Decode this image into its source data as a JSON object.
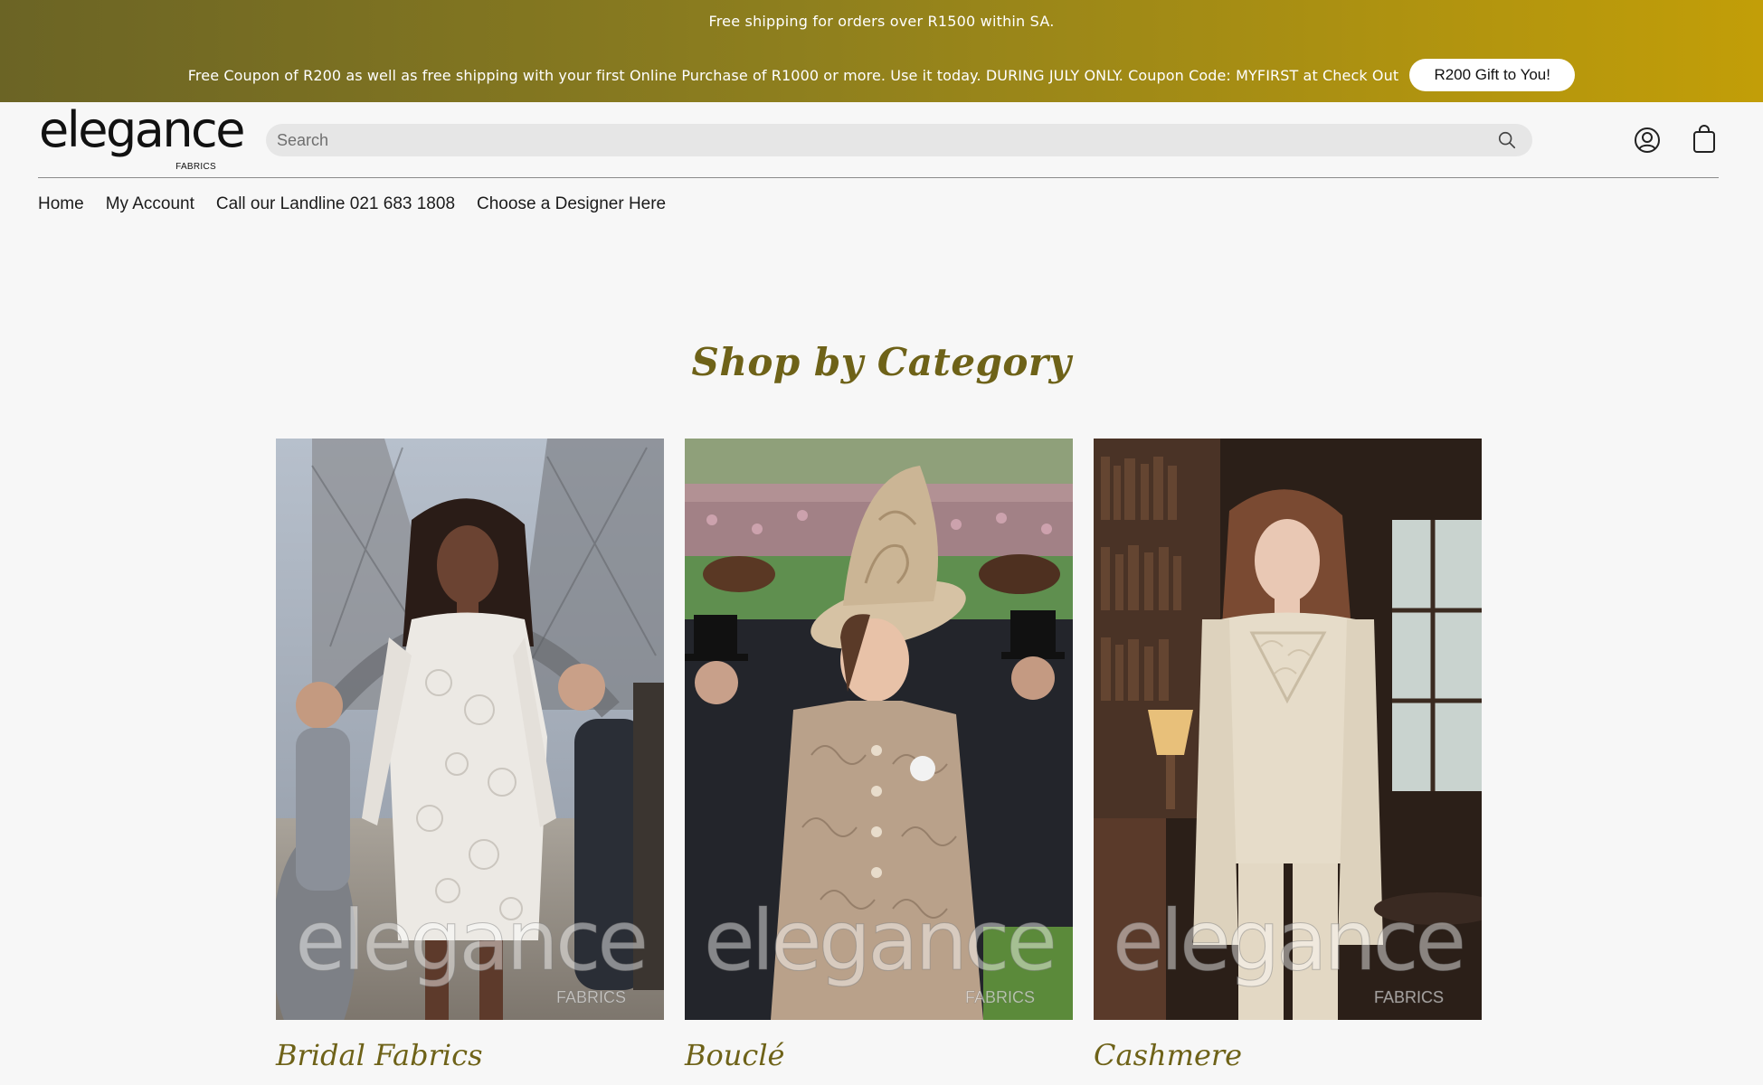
{
  "announcement": {
    "line1": "Free shipping for orders over R1500 within SA.",
    "line2": "Free Coupon of R200 as well as free shipping with your first Online Purchase of R1000 or more. Use it today. DURING JULY ONLY. Coupon Code: MYFIRST at Check Out",
    "gift_button_label": "R200 Gift to You!"
  },
  "header": {
    "logo_text": "elegance",
    "logo_subtext": "FABRICS",
    "search_placeholder": "Search",
    "icons": [
      "search-icon",
      "account-icon",
      "cart-icon"
    ]
  },
  "nav": {
    "items": [
      {
        "label": "Home"
      },
      {
        "label": "My Account"
      },
      {
        "label": "Call our Landline 021 683 1808"
      },
      {
        "label": "Choose a Designer Here"
      }
    ]
  },
  "section": {
    "title": "Shop by Category"
  },
  "categories": [
    {
      "label": "Bridal Fabrics",
      "image_alt": "Model in white lace dress in front of Eiffel Tower"
    },
    {
      "label": "Bouclé",
      "image_alt": "Woman in bouclé suit and hat at horse races"
    },
    {
      "label": "Cashmere",
      "image_alt": "Woman in cream cashmere outfit in library"
    }
  ],
  "watermark": {
    "text": "elegance",
    "subtext": "FABRICS"
  },
  "colors": {
    "accent": "#6e6218",
    "banner_start": "#6b6425",
    "banner_end": "#c29e08"
  }
}
